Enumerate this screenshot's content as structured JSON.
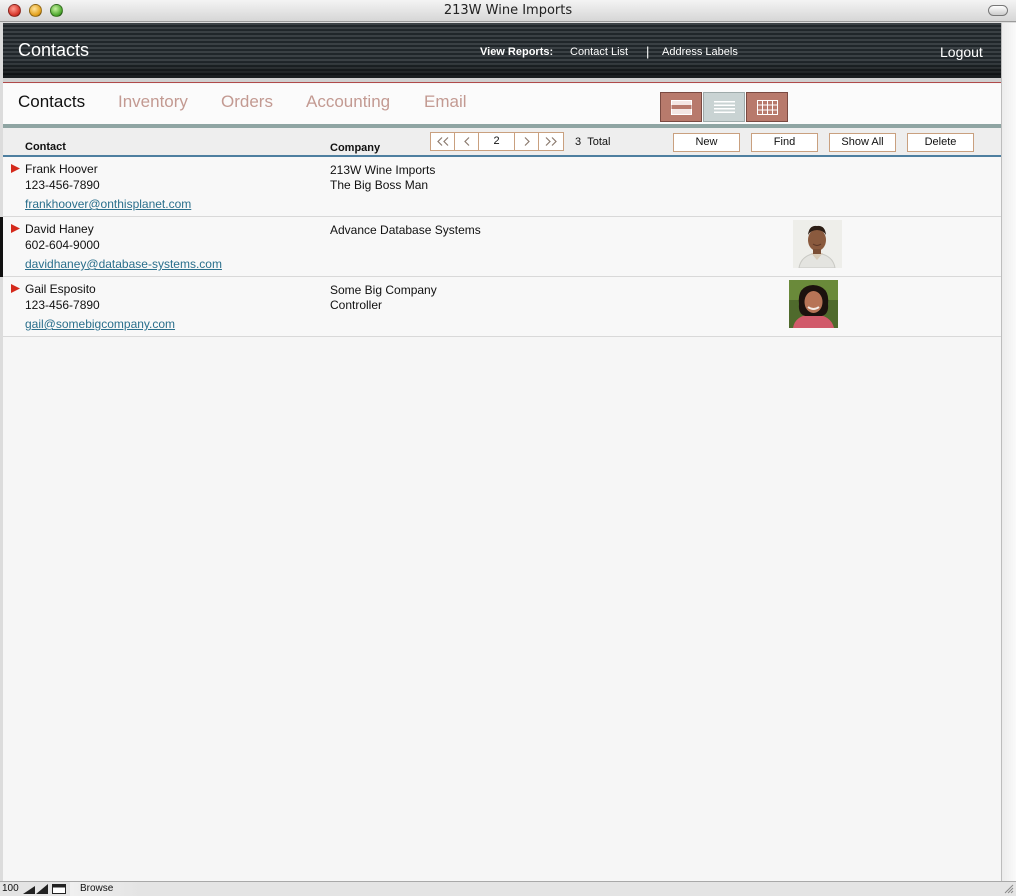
{
  "window": {
    "title": "213W Wine Imports"
  },
  "header": {
    "title": "Contacts",
    "reports_label": "View Reports:",
    "report_links": [
      "Contact List",
      "Address Labels"
    ],
    "separator": "|",
    "logout": "Logout"
  },
  "tabs": [
    {
      "label": "Contacts",
      "active": true
    },
    {
      "label": "Inventory",
      "active": false
    },
    {
      "label": "Orders",
      "active": false
    },
    {
      "label": "Accounting",
      "active": false
    },
    {
      "label": "Email",
      "active": false
    }
  ],
  "view_buttons": {
    "form": "form-view-icon",
    "list": "list-view-icon",
    "table": "table-view-icon",
    "active": "list"
  },
  "list_header": {
    "contact_label": "Contact",
    "company_label": "Company",
    "record_number": "2",
    "total_count": "3",
    "total_label": "Total",
    "buttons": {
      "new": "New",
      "find": "Find",
      "show_all": "Show All",
      "delete": "Delete"
    }
  },
  "records": [
    {
      "name": "Frank Hoover",
      "phone": "123-456-7890",
      "email": "frankhoover@onthisplanet.com",
      "company": "213W Wine Imports",
      "title": "The Big Boss Man",
      "has_photo": false
    },
    {
      "name": "David Haney",
      "phone": "602-604-9000",
      "email": "davidhaney@database-systems.com",
      "company": "Advance Database Systems",
      "title": "",
      "has_photo": true
    },
    {
      "name": "Gail Esposito",
      "phone": "123-456-7890",
      "email": "gail@somebigcompany.com",
      "company": "Some Big Company",
      "title": "Controller",
      "has_photo": true
    }
  ],
  "status_bar": {
    "zoom": "100",
    "mode": "Browse"
  },
  "colors": {
    "tab_inactive": "#c39a92",
    "link": "#2a6f8c",
    "view_button": "#b87a6c",
    "accent_rule": "#8fa5a3",
    "header_border": "#4e7fa0"
  }
}
